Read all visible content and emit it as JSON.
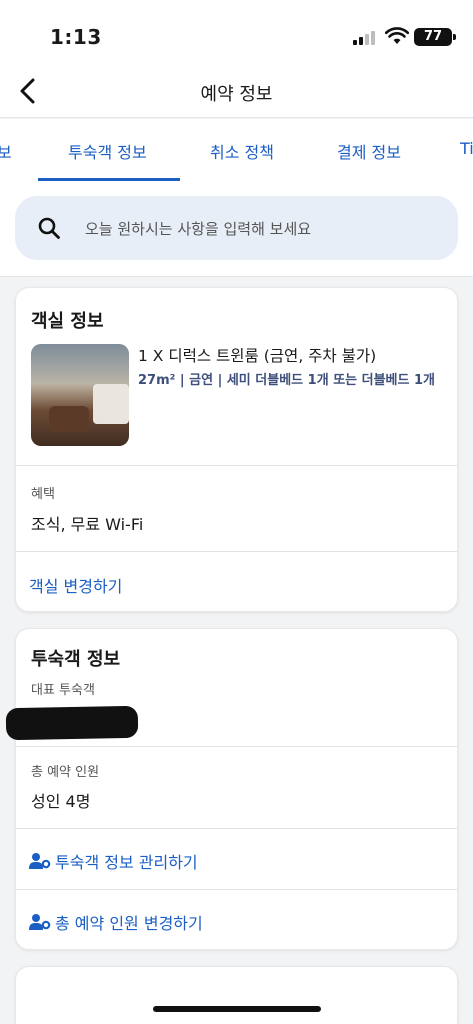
{
  "status_bar": {
    "time": "1:13",
    "battery": "77"
  },
  "nav": {
    "title": "예약 정보"
  },
  "tabs": [
    {
      "label": "보"
    },
    {
      "label": "투숙객 정보",
      "active": true
    },
    {
      "label": "취소 정책"
    },
    {
      "label": "결제 정보"
    },
    {
      "label": "Ti"
    }
  ],
  "search": {
    "placeholder": "오늘 원하시는 사항을 입력해 보세요"
  },
  "room_card": {
    "title": "객실 정보",
    "room_name": "1 X 디럭스 트윈룸 (금연, 주차 불가)",
    "room_detail": "27m² | 금연 | 세미 더블베드 1개 또는 더블베드 1개",
    "benefits_label": "혜택",
    "benefits_value": "조식, 무료 Wi-Fi",
    "change_link": "객실 변경하기"
  },
  "guest_card": {
    "title": "투숙객 정보",
    "lead_guest_label": "대표 투숙객",
    "total_label": "총 예약 인원",
    "total_value": "성인 4명",
    "manage_link": "투숙객 정보 관리하기",
    "change_count_link": "총 예약 인원 변경하기"
  },
  "colors": {
    "accent": "#1b5fc4",
    "search_bg": "#e8eef7"
  }
}
